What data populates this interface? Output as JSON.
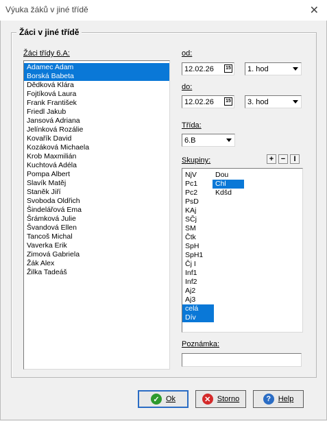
{
  "window": {
    "title": "Výuka žáků v jiné třídě"
  },
  "group": {
    "title": "Žáci v jiné třídě"
  },
  "students": {
    "label": "Žáci třídy 6.A:",
    "items": [
      {
        "name": "Adamec Adam",
        "selected": true
      },
      {
        "name": "Borská Babeta",
        "selected": true
      },
      {
        "name": "Dědková Klára",
        "selected": false
      },
      {
        "name": "Fojtíková Laura",
        "selected": false
      },
      {
        "name": "Frank František",
        "selected": false
      },
      {
        "name": "Friedl Jakub",
        "selected": false
      },
      {
        "name": "Jansová Adriana",
        "selected": false
      },
      {
        "name": "Jelínková Rozálie",
        "selected": false
      },
      {
        "name": "Kovařík David",
        "selected": false
      },
      {
        "name": "Kozáková Michaela",
        "selected": false
      },
      {
        "name": "Krob Maxmilián",
        "selected": false
      },
      {
        "name": "Kuchtová Adéla",
        "selected": false
      },
      {
        "name": "Pompa Albert",
        "selected": false
      },
      {
        "name": "Slavík Matěj",
        "selected": false
      },
      {
        "name": "Staněk Jiří",
        "selected": false
      },
      {
        "name": "Svoboda Oldřich",
        "selected": false
      },
      {
        "name": "Šindelářová Ema",
        "selected": false
      },
      {
        "name": "Šrámková Julie",
        "selected": false
      },
      {
        "name": "Švandová Ellen",
        "selected": false
      },
      {
        "name": "Tancoš Michal",
        "selected": false
      },
      {
        "name": "Vaverka Erik",
        "selected": false
      },
      {
        "name": "Zimová Gabriela",
        "selected": false
      },
      {
        "name": "Žák Alex",
        "selected": false
      },
      {
        "name": "Žilka Tadeáš",
        "selected": false
      }
    ]
  },
  "from": {
    "label": "od:",
    "date": "12.02.26",
    "lesson": "1. hod"
  },
  "to": {
    "label": "do:",
    "date": "12.02.26",
    "lesson": "3. hod"
  },
  "class": {
    "label": "Třída:",
    "value": "6.B"
  },
  "groups": {
    "label": "Skupiny:",
    "add_label": "+",
    "remove_label": "−",
    "edit_label": "I",
    "col1": [
      {
        "name": "NjV",
        "selected": false
      },
      {
        "name": "Pc1",
        "selected": false
      },
      {
        "name": "Pc2",
        "selected": false
      },
      {
        "name": "PsD",
        "selected": false
      },
      {
        "name": "KAj",
        "selected": false
      },
      {
        "name": "SČj",
        "selected": false
      },
      {
        "name": "SM",
        "selected": false
      },
      {
        "name": "Čtk",
        "selected": false
      },
      {
        "name": "SpH",
        "selected": false
      },
      {
        "name": "SpH1",
        "selected": false
      },
      {
        "name": "Čj I",
        "selected": false
      },
      {
        "name": "Inf1",
        "selected": false
      },
      {
        "name": "Inf2",
        "selected": false
      },
      {
        "name": "Aj2",
        "selected": false
      },
      {
        "name": "Aj3",
        "selected": false
      },
      {
        "name": "celá",
        "selected": true
      },
      {
        "name": "Dív",
        "selected": true
      }
    ],
    "col2": [
      {
        "name": "Dou",
        "selected": false
      },
      {
        "name": "Chl",
        "selected": true
      },
      {
        "name": "Kdšd",
        "selected": false
      }
    ]
  },
  "note": {
    "label": "Poznámka:",
    "value": ""
  },
  "buttons": {
    "ok": "Ok",
    "cancel": "Storno",
    "help": "Help"
  },
  "colors": {
    "selection": "#0a78d7",
    "ok_icon": "#2e9a2e",
    "cancel_icon": "#d42a2a",
    "help_icon": "#2a6cc4"
  }
}
